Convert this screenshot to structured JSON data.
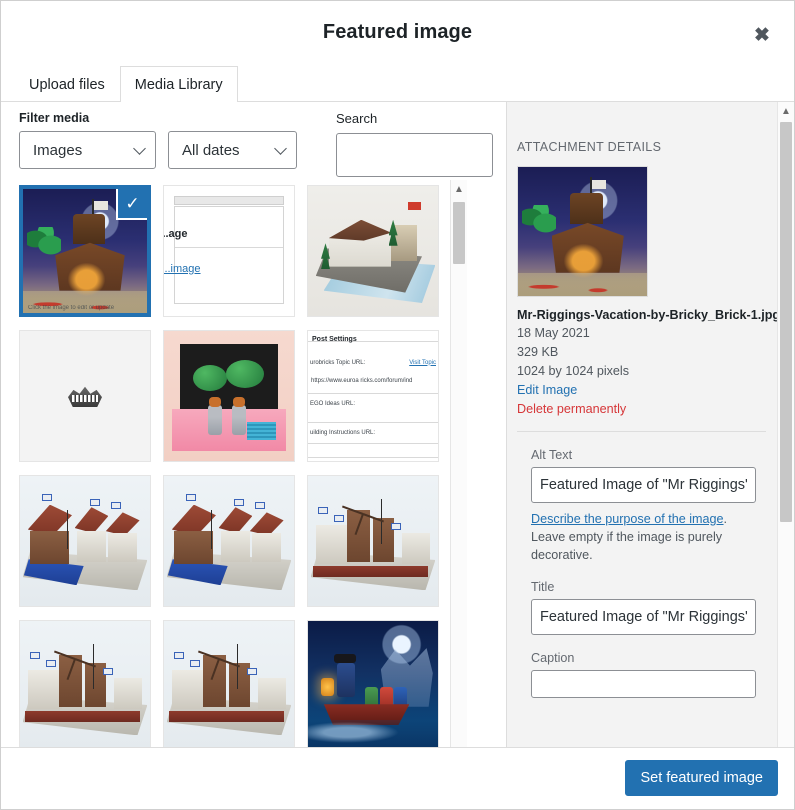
{
  "header": {
    "title": "Featured image",
    "close_label": "✖"
  },
  "tabs": [
    {
      "label": "Upload files",
      "active": false
    },
    {
      "label": "Media Library",
      "active": true
    }
  ],
  "filter": {
    "label": "Filter media",
    "type_value": "Images",
    "date_value": "All dates",
    "search_label": "Search",
    "search_value": "",
    "search_placeholder": ""
  },
  "grid": {
    "selected_caption": "Click the image to edit or update",
    "items": [
      {
        "name": "tropical-hut-night",
        "art": "art-night",
        "selected": true
      },
      {
        "name": "screenshot-featured-image",
        "art": "art-screenshot",
        "selected": false,
        "ss_text": "...age",
        "ss_link": "...image"
      },
      {
        "name": "white-building-by-water",
        "art": "art-white-bldg",
        "selected": false
      },
      {
        "name": "logo-placeholder",
        "art": "art-logo",
        "selected": false
      },
      {
        "name": "pink-diorama-minifigs",
        "art": "art-pink",
        "selected": false
      },
      {
        "name": "screenshot-post-settings",
        "art": "art-screenshot-2",
        "selected": false,
        "ss_title": "Post Settings",
        "ss_rows": [
          "urobricks Topic URL:",
          "https://www.euroa ricks.com/forum/ind",
          "EGO Ideas URL:",
          "uilding Instructions URL:"
        ],
        "ss_link": "Visit Topic"
      },
      {
        "name": "harbor-village-1",
        "art": "art-village",
        "selected": false
      },
      {
        "name": "harbor-village-2",
        "art": "art-village",
        "selected": false
      },
      {
        "name": "windmill-village-1",
        "art": "art-village2",
        "selected": false
      },
      {
        "name": "windmill-village-2",
        "art": "art-village2",
        "selected": false
      },
      {
        "name": "windmill-village-3",
        "art": "art-village2",
        "selected": false
      },
      {
        "name": "pirate-night-boat",
        "art": "art-pirate",
        "selected": false
      }
    ]
  },
  "sidebar": {
    "heading": "ATTACHMENT DETAILS",
    "filename": "Mr-Riggings-Vacation-by-Bricky_Brick-1.jpg",
    "date": "18 May 2021",
    "filesize": "329 KB",
    "dimensions": "1024 by 1024 pixels",
    "edit_link": "Edit Image",
    "delete_link": "Delete permanently",
    "alt_label": "Alt Text",
    "alt_value": "Featured Image of \"Mr Riggings' Vacation\" by Bricky_Brick",
    "alt_help_link": "Describe the purpose of the image",
    "alt_help_text": ". Leave empty if the image is purely decorative.",
    "title_label": "Title",
    "title_value": "Featured Image of \"Mr Riggings' Vacation\" by Bricky_Brick",
    "caption_label": "Caption",
    "caption_value": ""
  },
  "footer": {
    "primary_button": "Set featured image"
  },
  "colors": {
    "accent": "#2271b1",
    "danger": "#d63638",
    "border": "#dddddd",
    "panel": "#f3f3f3"
  }
}
